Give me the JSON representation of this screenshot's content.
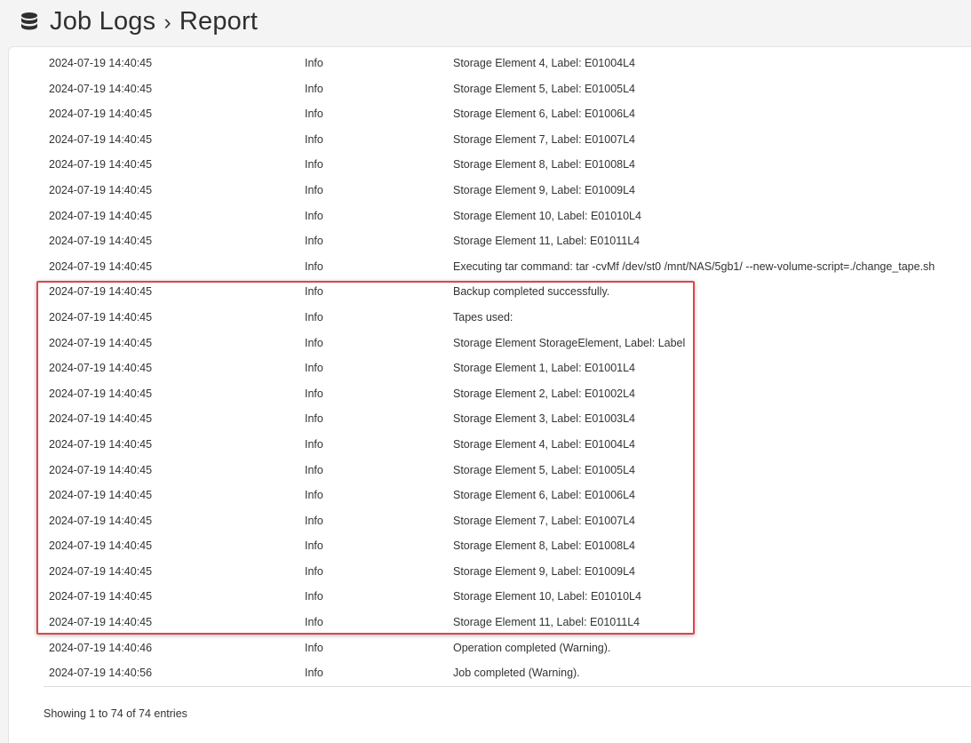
{
  "header": {
    "title": "Job Logs",
    "separator": "›",
    "subtitle": "Report",
    "icon": "database-icon"
  },
  "log_rows": [
    {
      "date": "2024-07-19 14:40:45",
      "level": "Info",
      "message": "Storage Element 4, Label: E01004L4"
    },
    {
      "date": "2024-07-19 14:40:45",
      "level": "Info",
      "message": "Storage Element 5, Label: E01005L4"
    },
    {
      "date": "2024-07-19 14:40:45",
      "level": "Info",
      "message": "Storage Element 6, Label: E01006L4"
    },
    {
      "date": "2024-07-19 14:40:45",
      "level": "Info",
      "message": "Storage Element 7, Label: E01007L4"
    },
    {
      "date": "2024-07-19 14:40:45",
      "level": "Info",
      "message": "Storage Element 8, Label: E01008L4"
    },
    {
      "date": "2024-07-19 14:40:45",
      "level": "Info",
      "message": "Storage Element 9, Label: E01009L4"
    },
    {
      "date": "2024-07-19 14:40:45",
      "level": "Info",
      "message": "Storage Element 10, Label: E01010L4"
    },
    {
      "date": "2024-07-19 14:40:45",
      "level": "Info",
      "message": "Storage Element 11, Label: E01011L4"
    },
    {
      "date": "2024-07-19 14:40:45",
      "level": "Info",
      "message": "Executing tar command: tar -cvMf /dev/st0 /mnt/NAS/5gb1/ --new-volume-script=./change_tape.sh"
    },
    {
      "date": "2024-07-19 14:40:45",
      "level": "Info",
      "message": "Backup completed successfully."
    },
    {
      "date": "2024-07-19 14:40:45",
      "level": "Info",
      "message": "Tapes used:"
    },
    {
      "date": "2024-07-19 14:40:45",
      "level": "Info",
      "message": "Storage Element StorageElement, Label: Label"
    },
    {
      "date": "2024-07-19 14:40:45",
      "level": "Info",
      "message": "Storage Element 1, Label: E01001L4"
    },
    {
      "date": "2024-07-19 14:40:45",
      "level": "Info",
      "message": "Storage Element 2, Label: E01002L4"
    },
    {
      "date": "2024-07-19 14:40:45",
      "level": "Info",
      "message": "Storage Element 3, Label: E01003L4"
    },
    {
      "date": "2024-07-19 14:40:45",
      "level": "Info",
      "message": "Storage Element 4, Label: E01004L4"
    },
    {
      "date": "2024-07-19 14:40:45",
      "level": "Info",
      "message": "Storage Element 5, Label: E01005L4"
    },
    {
      "date": "2024-07-19 14:40:45",
      "level": "Info",
      "message": "Storage Element 6, Label: E01006L4"
    },
    {
      "date": "2024-07-19 14:40:45",
      "level": "Info",
      "message": "Storage Element 7, Label: E01007L4"
    },
    {
      "date": "2024-07-19 14:40:45",
      "level": "Info",
      "message": "Storage Element 8, Label: E01008L4"
    },
    {
      "date": "2024-07-19 14:40:45",
      "level": "Info",
      "message": "Storage Element 9, Label: E01009L4"
    },
    {
      "date": "2024-07-19 14:40:45",
      "level": "Info",
      "message": "Storage Element 10, Label: E01010L4"
    },
    {
      "date": "2024-07-19 14:40:45",
      "level": "Info",
      "message": "Storage Element 11, Label: E01011L4"
    },
    {
      "date": "2024-07-19 14:40:46",
      "level": "Info",
      "message": "Operation completed (Warning)."
    },
    {
      "date": "2024-07-19 14:40:56",
      "level": "Info",
      "message": "Job completed (Warning)."
    }
  ],
  "footer": {
    "info": "Showing 1 to 74 of 74 entries"
  },
  "colors": {
    "highlight": "#e0444c",
    "background": "#f4f4f4",
    "card": "#ffffff"
  }
}
